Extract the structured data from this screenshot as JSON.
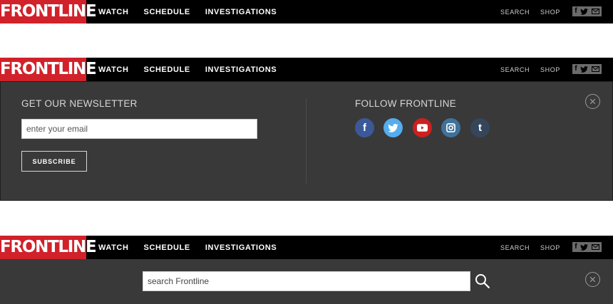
{
  "brand": {
    "logo_text": "FRONTLINE",
    "brand_red": "#d1212a"
  },
  "nav": {
    "items": [
      "WATCH",
      "SCHEDULE",
      "INVESTIGATIONS"
    ]
  },
  "utility": {
    "search_label": "SEARCH",
    "shop_label": "SHOP",
    "social_icons": [
      "facebook-icon",
      "twitter-icon",
      "mail-icon"
    ]
  },
  "newsletter": {
    "heading": "GET OUR NEWSLETTER",
    "email_placeholder": "enter your email",
    "subscribe_label": "SUBSCRIBE"
  },
  "follow": {
    "heading": "FOLLOW FRONTLINE",
    "networks": [
      {
        "name": "facebook",
        "color": "#3b5998"
      },
      {
        "name": "twitter",
        "color": "#55acee"
      },
      {
        "name": "youtube",
        "color": "#cd201f"
      },
      {
        "name": "instagram",
        "color": "#3f729b"
      },
      {
        "name": "tumblr",
        "color": "#35465c"
      }
    ]
  },
  "search": {
    "placeholder": "search Frontline"
  }
}
